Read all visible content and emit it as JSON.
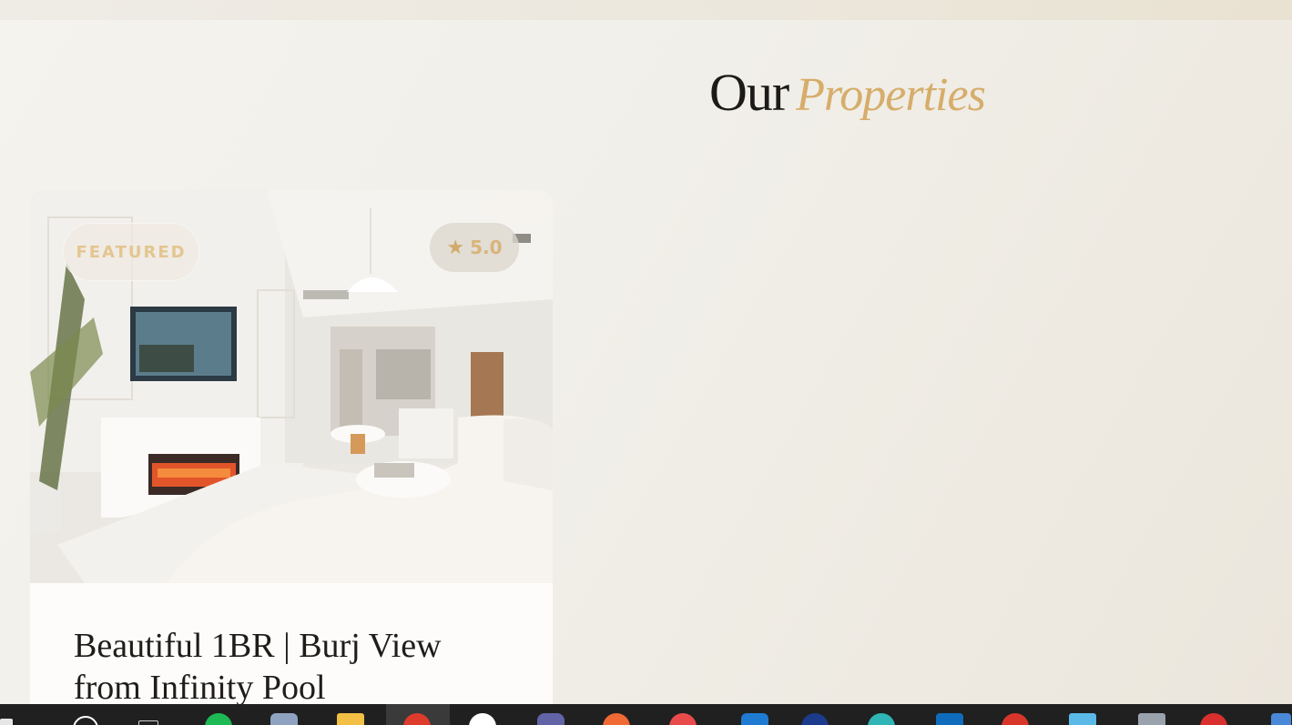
{
  "section": {
    "title_plain": "Our",
    "title_accent": "Properties"
  },
  "property_card": {
    "badge_featured": "FEATURED",
    "rating": "5.0",
    "title": "Beautiful 1BR | Burj View from Infinity Pool"
  },
  "taskbar": {
    "icons": [
      "windows-start-icon",
      "search-icon",
      "task-view-icon",
      "spotify-icon",
      "app-icon",
      "file-explorer-icon",
      "chrome-icon",
      "slack-icon",
      "teams-icon",
      "app-icon",
      "app-icon",
      "vscode-icon",
      "app-icon",
      "app-icon",
      "outlook-icon",
      "app-icon",
      "app-icon",
      "app-icon",
      "app-icon"
    ]
  },
  "colors": {
    "accent_gold": "#d6ad6a",
    "title_dark": "#1d1b18",
    "background": "#f3f1ec"
  }
}
